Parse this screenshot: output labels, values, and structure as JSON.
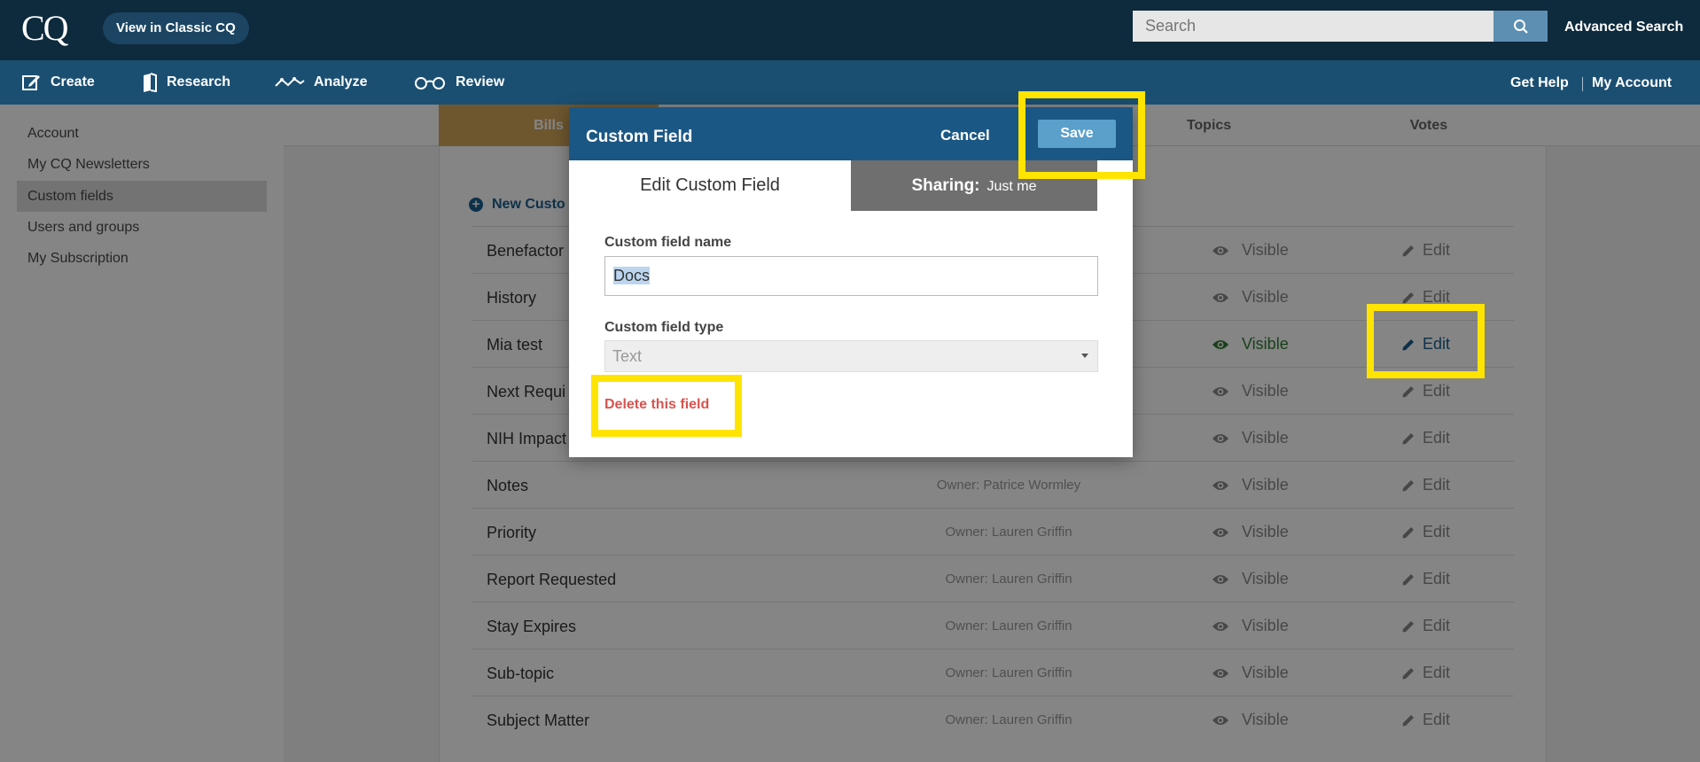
{
  "header": {
    "logo": "CQ",
    "classic_button": "View in Classic CQ",
    "search_placeholder": "Search",
    "advanced_search": "Advanced Search"
  },
  "nav": {
    "items": [
      {
        "label": "Create",
        "icon": "edit-icon"
      },
      {
        "label": "Research",
        "icon": "book-icon"
      },
      {
        "label": "Analyze",
        "icon": "line-chart-icon"
      },
      {
        "label": "Review",
        "icon": "glasses-icon"
      }
    ],
    "get_help": "Get Help",
    "my_account": "My Account"
  },
  "sidebar": {
    "items": [
      {
        "label": "Account",
        "active": false
      },
      {
        "label": "My CQ Newsletters",
        "active": false
      },
      {
        "label": "Custom fields",
        "active": true
      },
      {
        "label": "Users and groups",
        "active": false
      },
      {
        "label": "My Subscription",
        "active": false
      }
    ]
  },
  "tabs": [
    "Bills",
    "Topics",
    "Votes"
  ],
  "list": {
    "new_field": "New Custo",
    "rows": [
      {
        "name": "Benefactor",
        "owner": "",
        "visibility": "Visible",
        "edit": "Edit"
      },
      {
        "name": "History",
        "owner": "",
        "visibility": "Visible",
        "edit": "Edit"
      },
      {
        "name": "Mia test",
        "owner": "",
        "visibility": "Visible",
        "edit": "Edit"
      },
      {
        "name": "Next Requi",
        "owner": "",
        "visibility": "Visible",
        "edit": "Edit"
      },
      {
        "name": "NIH Impact",
        "owner": "",
        "visibility": "Visible",
        "edit": "Edit"
      },
      {
        "name": "Notes",
        "owner": "Owner: Patrice Wormley",
        "visibility": "Visible",
        "edit": "Edit"
      },
      {
        "name": "Priority",
        "owner": "Owner: Lauren Griffin",
        "visibility": "Visible",
        "edit": "Edit"
      },
      {
        "name": "Report Requested",
        "owner": "Owner: Lauren Griffin",
        "visibility": "Visible",
        "edit": "Edit"
      },
      {
        "name": "Stay Expires",
        "owner": "Owner: Lauren Griffin",
        "visibility": "Visible",
        "edit": "Edit"
      },
      {
        "name": "Sub-topic",
        "owner": "Owner: Lauren Griffin",
        "visibility": "Visible",
        "edit": "Edit"
      },
      {
        "name": "Subject Matter",
        "owner": "Owner: Lauren Griffin",
        "visibility": "Visible",
        "edit": "Edit"
      }
    ]
  },
  "modal": {
    "title": "Custom Field",
    "cancel": "Cancel",
    "save": "Save",
    "tab_edit": "Edit Custom Field",
    "tab_sharing": "Sharing:",
    "sharing_value": "Just me",
    "name_label": "Custom field name",
    "name_value": "Docs",
    "type_label": "Custom field type",
    "type_value": "Text",
    "delete_link": "Delete this field"
  },
  "colors": {
    "topbar": "#0e2a3d",
    "navbar": "#1b4f72",
    "modal_header": "#1b5784",
    "save_button": "#5b9fcb",
    "active_tab": "#d4a85b",
    "highlight": "#ffe400",
    "delete": "#d9534f"
  }
}
